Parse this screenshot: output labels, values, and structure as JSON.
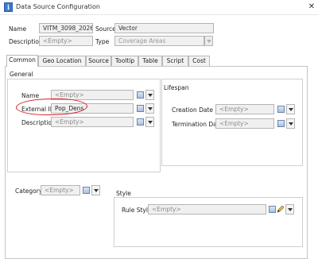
{
  "window": {
    "title": "Data Source Configuration",
    "close_glyph": "✕",
    "app_icon_glyph": "i"
  },
  "header": {
    "name_label": "Name",
    "name_value": "VITM_3098_2026",
    "source_label": "Source",
    "source_value": "Vector",
    "description_label": "Description",
    "description_value": "<Empty>",
    "type_label": "Type",
    "type_value": "Coverage Areas"
  },
  "tabs": [
    "Common",
    "Geo Location",
    "Source",
    "Tooltip",
    "Table",
    "Script",
    "Cost"
  ],
  "active_tab": "Common",
  "general": {
    "section_label": "General",
    "name_label": "Name",
    "name_value": "<Empty>",
    "external_id_label": "External ID",
    "external_id_value": "Pop_Dens",
    "description_label": "Description",
    "description_value": "<Empty>"
  },
  "lifespan": {
    "section_label": "Lifespan",
    "creation_label": "Creation Date",
    "creation_value": "<Empty>",
    "termination_label": "Termination Date",
    "termination_value": "<Empty>"
  },
  "category": {
    "label": "Category",
    "value": "<Empty>"
  },
  "style": {
    "section_label": "Style",
    "rule_style_label": "Rule Style",
    "rule_style_value": "<Empty>"
  },
  "colors": {
    "annotation_red": "#d3232b",
    "titlebar_icon": "#3c77c9"
  }
}
